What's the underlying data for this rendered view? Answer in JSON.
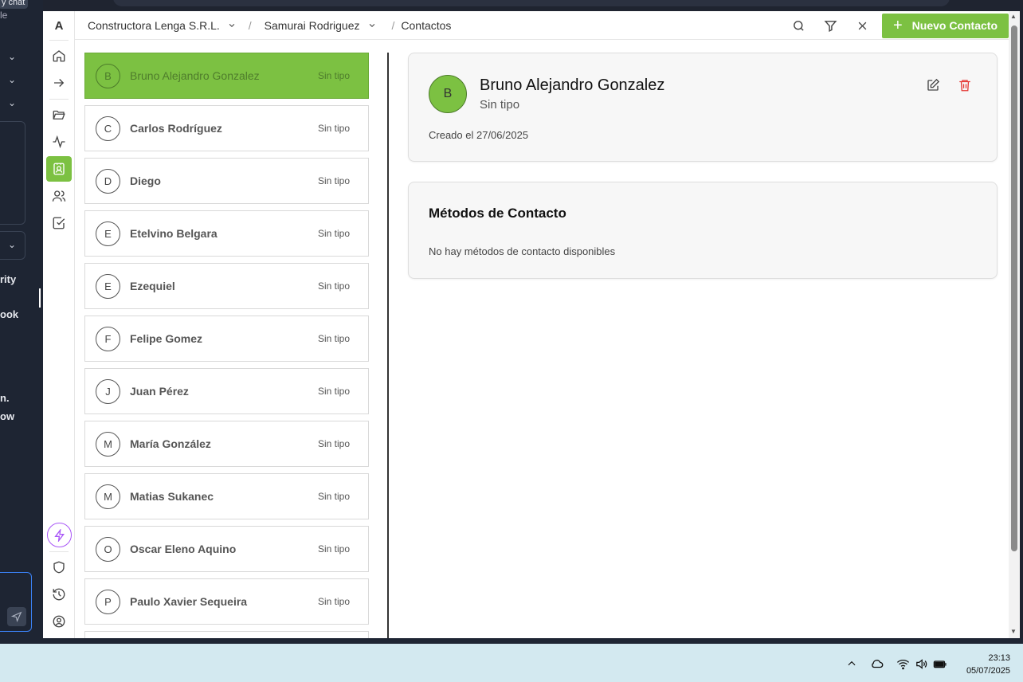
{
  "left_panel": {
    "fragments": [
      "y chat",
      "le",
      "rity",
      "ook",
      "n.",
      "ow"
    ]
  },
  "header": {
    "breadcrumb": [
      {
        "label": "Constructora Lenga S.R.L.",
        "has_dropdown": true
      },
      {
        "label": "Samurai Rodriguez",
        "has_dropdown": true
      },
      {
        "label": "Contactos",
        "has_dropdown": false
      }
    ],
    "separator": "/",
    "new_contact_label": "Nuevo Contacto",
    "new_contact_plus": "+"
  },
  "rail": {
    "logo": "A",
    "items": [
      "home-icon",
      "arrow-right-icon",
      "folder-open-icon",
      "activity-icon",
      "contacts-icon",
      "users-icon",
      "check-square-icon"
    ],
    "active": "contacts-icon",
    "bottom": [
      "bolt-icon",
      "shield-icon",
      "history-icon",
      "user-circle-icon"
    ]
  },
  "contacts": [
    {
      "initial": "B",
      "name": "Bruno Alejandro Gonzalez",
      "type": "Sin tipo",
      "selected": true
    },
    {
      "initial": "C",
      "name": "Carlos Rodríguez",
      "type": "Sin tipo"
    },
    {
      "initial": "D",
      "name": "Diego",
      "type": "Sin tipo"
    },
    {
      "initial": "E",
      "name": "Etelvino Belgara",
      "type": "Sin tipo"
    },
    {
      "initial": "E",
      "name": "Ezequiel",
      "type": "Sin tipo"
    },
    {
      "initial": "F",
      "name": "Felipe Gomez",
      "type": "Sin tipo"
    },
    {
      "initial": "J",
      "name": "Juan Pérez",
      "type": "Sin tipo"
    },
    {
      "initial": "M",
      "name": "María González",
      "type": "Sin tipo"
    },
    {
      "initial": "M",
      "name": "Matias Sukanec",
      "type": "Sin tipo"
    },
    {
      "initial": "O",
      "name": "Oscar Eleno Aquino",
      "type": "Sin tipo"
    },
    {
      "initial": "P",
      "name": "Paulo Xavier Sequeira",
      "type": "Sin tipo"
    },
    {
      "initial": "",
      "name": "",
      "type": ""
    }
  ],
  "detail": {
    "initial": "B",
    "name": "Bruno Alejandro Gonzalez",
    "type": "Sin tipo",
    "created": "Creado el 27/06/2025",
    "methods_title": "Métodos de Contacto",
    "methods_empty": "No hay métodos de contacto disponibles"
  },
  "colors": {
    "accent": "#7cc142",
    "delete": "#e53935",
    "bolt": "#a855f7"
  },
  "taskbar": {
    "time": "23:13",
    "date": "05/07/2025",
    "tray": [
      "chevron-up-icon",
      "cloud-icon",
      "wifi-icon",
      "volume-icon",
      "battery-icon"
    ]
  }
}
